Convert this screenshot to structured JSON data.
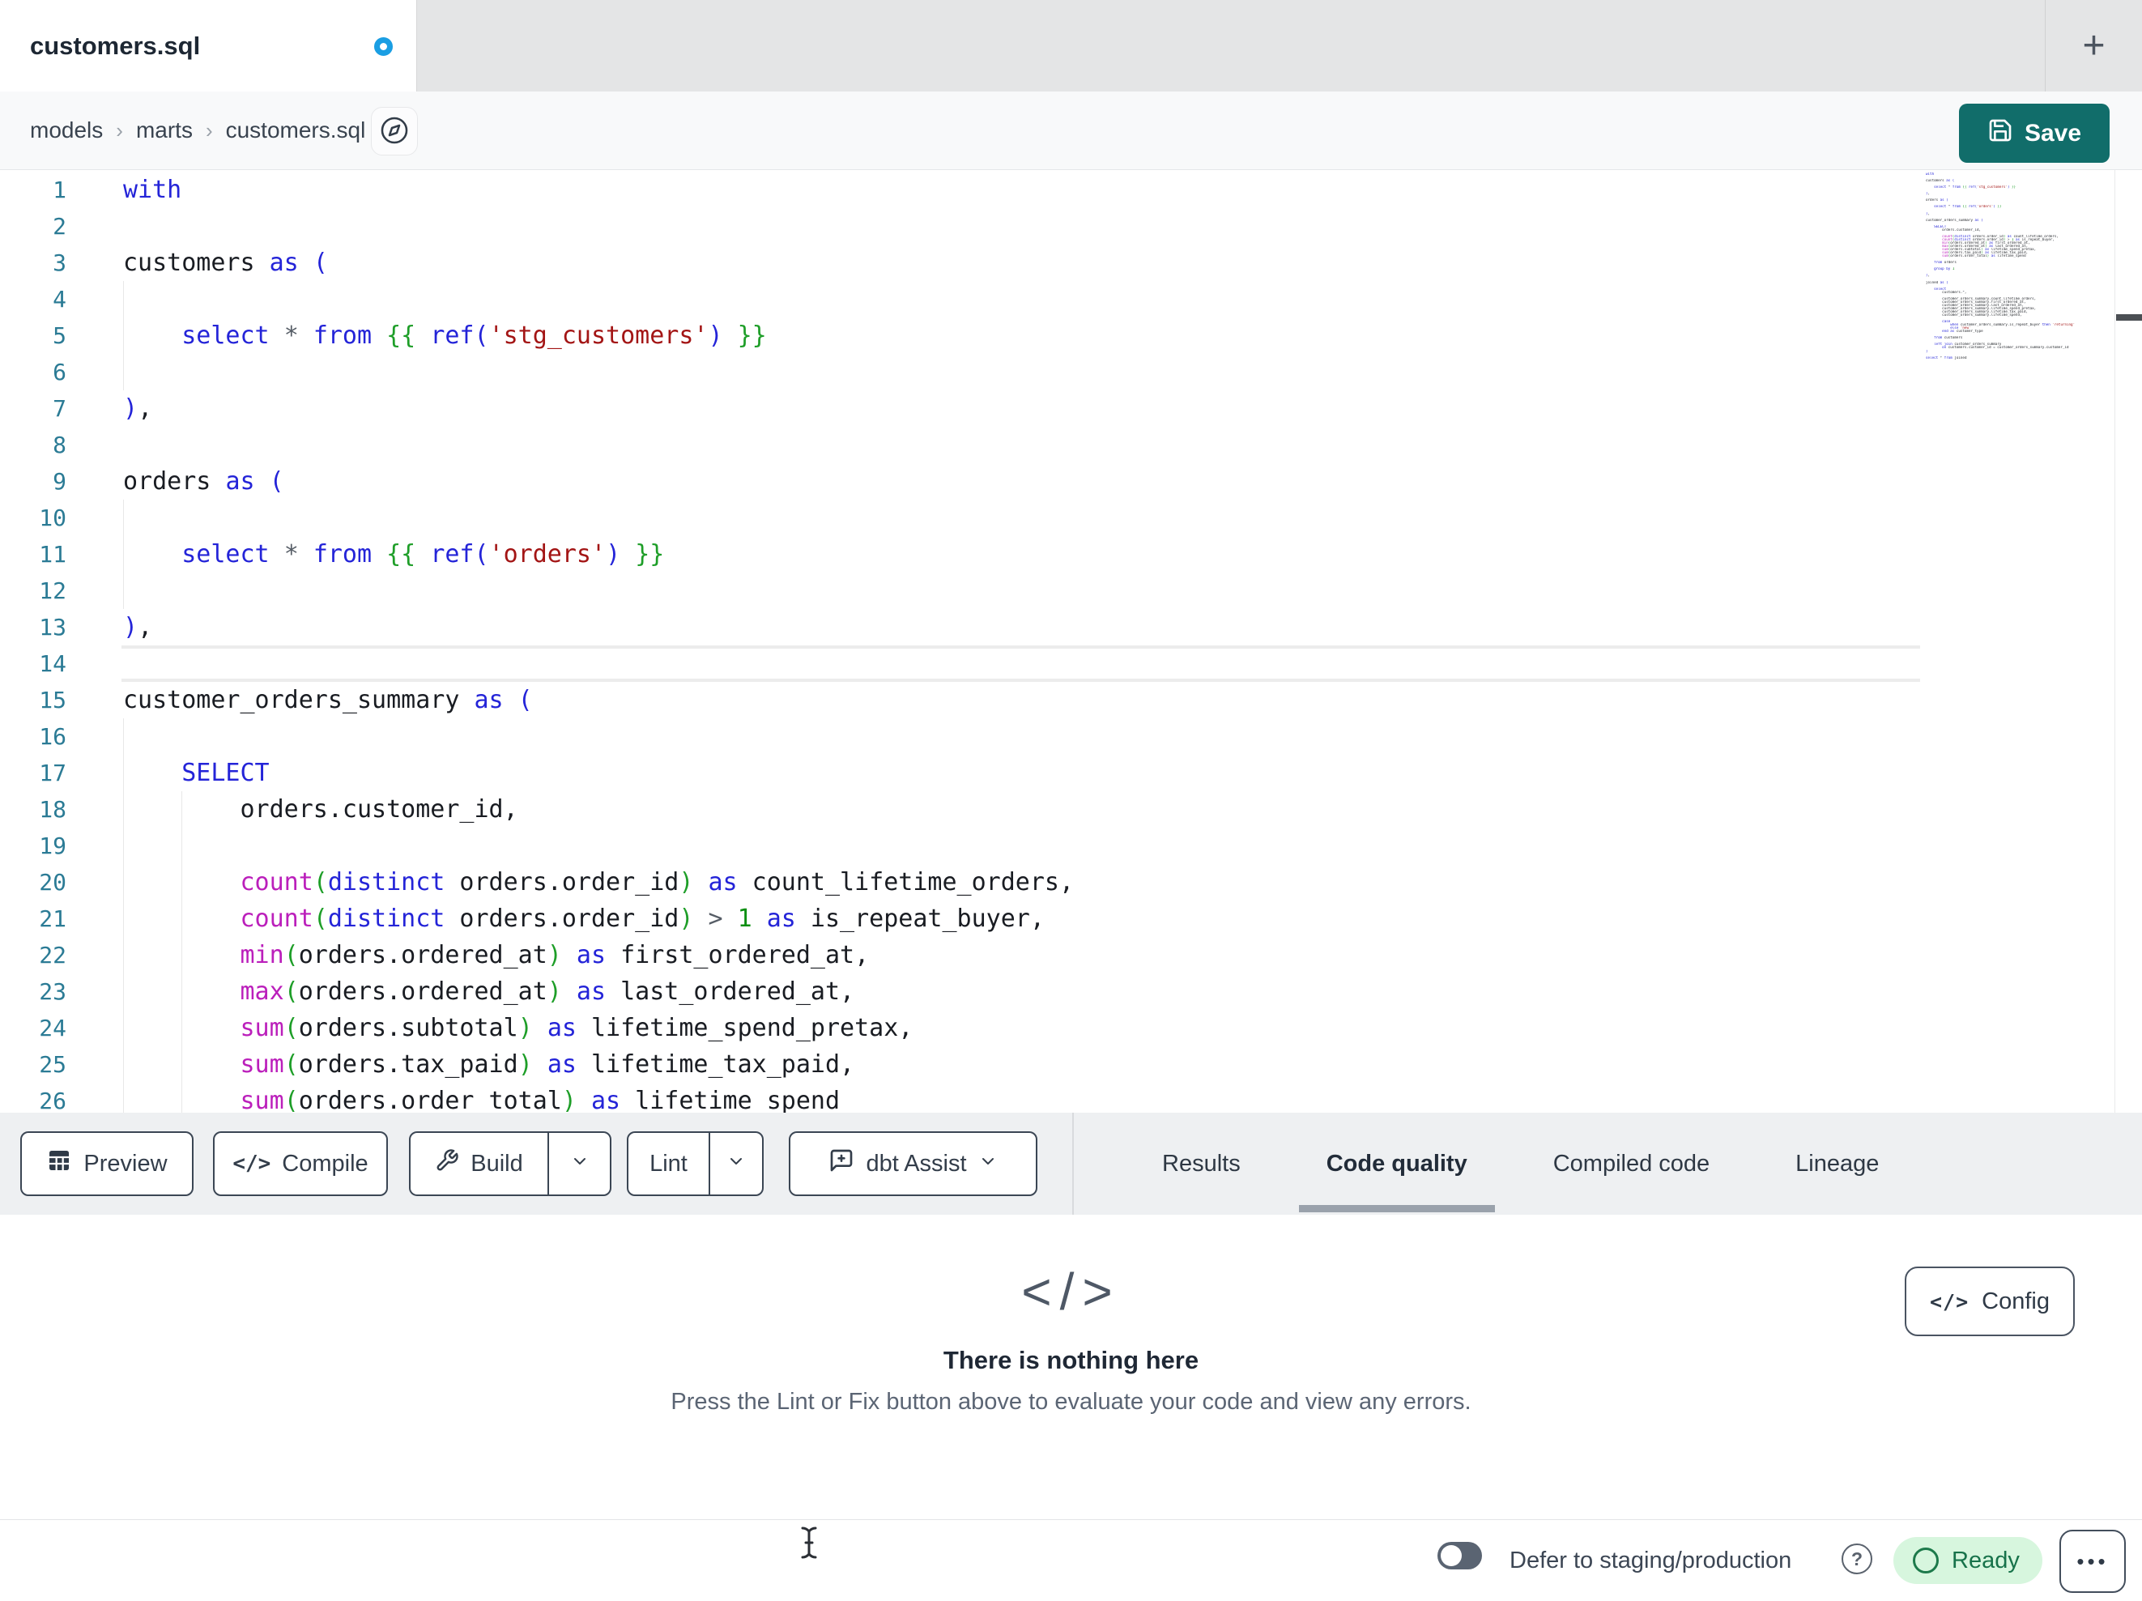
{
  "colors": {
    "accent-teal": "#116d6a",
    "dot-blue": "#1a9ee3",
    "kw": "#2424d8",
    "fn": "#bb1fbb",
    "str": "#a31515",
    "jinja": "#1e9e28",
    "num": "#0d8f12",
    "op": "#565d66",
    "code-text": "#191c22",
    "linenum": "#2b7b95",
    "btn-border": "#3b4654",
    "btn-text": "#333d4a",
    "underline": "#9aa2ac",
    "ready-bg": "#d7f6de",
    "ready-fg": "#17724a"
  },
  "tab_bar": {
    "active_tab_label": "customers.sql",
    "new_tab_label": "+"
  },
  "breadcrumb": {
    "items": [
      "models",
      "marts",
      "customers.sql"
    ],
    "separator": "›"
  },
  "header": {
    "save_label": "Save"
  },
  "code": {
    "active_line": 14,
    "visible_line_count": 26,
    "file_lines": [
      "with",
      "",
      "customers as (",
      "",
      "    select * from {{ ref('stg_customers') }}",
      "",
      "),",
      "",
      "orders as (",
      "",
      "    select * from {{ ref('orders') }}",
      "",
      "),",
      "",
      "customer_orders_summary as (",
      "",
      "    SELECT",
      "        orders.customer_id,",
      "",
      "        count(distinct orders.order_id) as count_lifetime_orders,",
      "        count(distinct orders.order_id) > 1 as is_repeat_buyer,",
      "        min(orders.ordered_at) as first_ordered_at,",
      "        max(orders.ordered_at) as last_ordered_at,",
      "        sum(orders.subtotal) as lifetime_spend_pretax,",
      "        sum(orders.tax_paid) as lifetime_tax_paid,",
      "        sum(orders.order_total) as lifetime_spend",
      "",
      "    from orders",
      "",
      "    group by 1",
      "",
      "),",
      "",
      "joined as (",
      "",
      "    select",
      "        customers.*,",
      "",
      "        customer_orders_summary.count_lifetime_orders,",
      "        customer_orders_summary.first_ordered_at,",
      "        customer_orders_summary.last_ordered_at,",
      "        customer_orders_summary.lifetime_spend_pretax,",
      "        customer_orders_summary.lifetime_tax_paid,",
      "        customer_orders_summary.lifetime_spend,",
      "",
      "        case",
      "            when customer_orders_summary.is_repeat_buyer then 'returning'",
      "            else 'new'",
      "        end as customer_type",
      "",
      "    from customers",
      "",
      "    left join customer_orders_summary",
      "        on customers.customer_id = customer_orders_summary.customer_id",
      ")",
      "",
      "select * from joined"
    ]
  },
  "toolbar": {
    "preview_label": "Preview",
    "compile_label": "Compile",
    "build_label": "Build",
    "lint_label": "Lint",
    "assist_label": "dbt Assist"
  },
  "panel": {
    "tabs": [
      "Results",
      "Code quality",
      "Compiled code",
      "Lineage"
    ],
    "active_tab": "Code quality",
    "empty_state": {
      "icon_glyph": "</>",
      "title": "There is nothing here",
      "subtitle": "Press the Lint or Fix button above to evaluate your code and view any errors.",
      "config_label": "Config",
      "config_icon_glyph": "</>"
    }
  },
  "status_bar": {
    "defer_label": "Defer to staging/production",
    "help_glyph": "?",
    "ready_label": "Ready",
    "more_glyph": "•••"
  }
}
